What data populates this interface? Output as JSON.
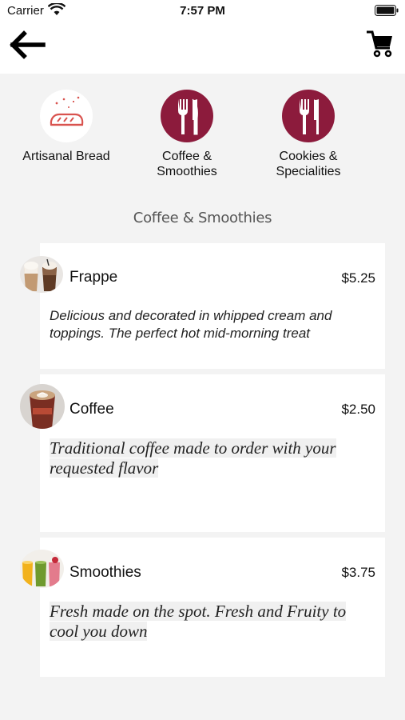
{
  "status": {
    "carrier": "Carrier",
    "time": "7:57 PM"
  },
  "nav": {
    "back_icon": "arrow-left-icon",
    "cart_icon": "shopping-cart-icon"
  },
  "categories": [
    {
      "label": "Artisanal Bread",
      "icon": "bread-icon"
    },
    {
      "label": "Coffee & Smoothies",
      "icon": "fork-knife-icon"
    },
    {
      "label": "Cookies & Specialities",
      "icon": "fork-knife-icon"
    }
  ],
  "section_title": "Coffee & Smoothies",
  "items": [
    {
      "name": "Frappe",
      "price": "$5.25",
      "description": "Delicious and decorated in whipped cream and toppings. The perfect hot mid-morning treat",
      "image": "frappe-photo"
    },
    {
      "name": "Coffee",
      "price": "$2.50",
      "description": "Traditional coffee made to order with your requested flavor",
      "image": "coffee-photo"
    },
    {
      "name": "Smoothies",
      "price": "$3.75",
      "description": "Fresh made on the spot. Fresh and Fruity to cool you down",
      "image": "smoothies-photo"
    }
  ],
  "colors": {
    "accent": "#8c1b3c",
    "bread_icon": "#d9534f",
    "background": "#f3f3f3",
    "card": "#ffffff"
  }
}
